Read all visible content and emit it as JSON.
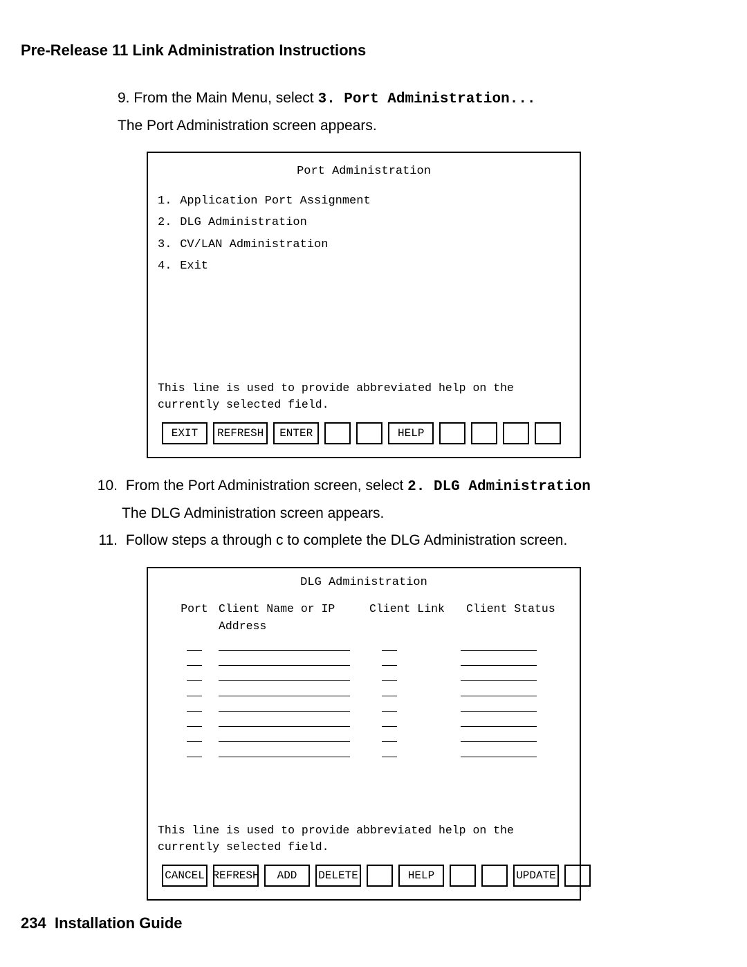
{
  "doc_title": "Pre-Release 11 Link Administration Instructions",
  "steps": {
    "s9": {
      "num": "9.",
      "text_prefix": "From the Main Menu, select ",
      "text_mono": "3. Port Administration...",
      "body": "The Port Administration screen appears."
    },
    "s10": {
      "num": "10.",
      "text_prefix": "From the Port Administration screen, select ",
      "text_mono": "2. DLG Administration",
      "body": "The DLG Administration screen appears."
    },
    "s11": {
      "num": "11.",
      "text": "Follow steps a through c to complete the DLG Administration screen."
    }
  },
  "terminal1": {
    "title": "Port Administration",
    "menu": [
      {
        "n": "1.",
        "label": "Application Port Assignment"
      },
      {
        "n": "2.",
        "label": "DLG Administration"
      },
      {
        "n": "3.",
        "label": "CV/LAN Administration"
      },
      {
        "n": "4.",
        "label": "Exit"
      }
    ],
    "help_line": "This line is used to provide abbreviated help on the currently selected field.",
    "buttons": [
      "EXIT",
      "REFRESH",
      "ENTER",
      "",
      "",
      "HELP",
      "",
      "",
      "",
      ""
    ]
  },
  "terminal2": {
    "title": "DLG Administration",
    "columns": {
      "port": "Port",
      "client": "Client Name or IP Address",
      "link": "Client Link",
      "status": "Client Status"
    },
    "row_count": 8,
    "help_line": "This line is used to provide abbreviated help on the currently selected field.",
    "buttons": [
      "CANCEL",
      "REFRESH",
      "ADD",
      "DELETE",
      "",
      "HELP",
      "",
      "",
      "UPDATE",
      ""
    ]
  },
  "footer": {
    "page": "234",
    "label": "Installation Guide"
  }
}
